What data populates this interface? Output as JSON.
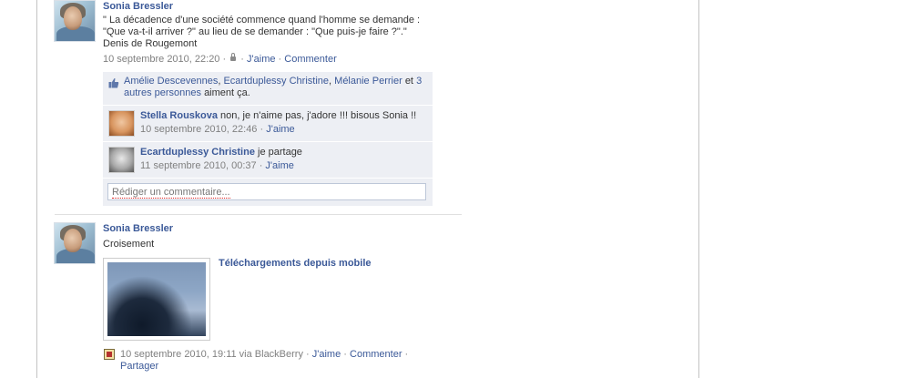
{
  "post1": {
    "author": "Sonia Bressler",
    "text_line1": "\" La décadence d'une société commence quand l'homme se demande :",
    "text_line2": "\"Que va-t-il arriver ?\" au lieu de se demander : \"Que puis-je faire ?\".\"",
    "text_line3": "Denis de Rougemont",
    "date": "10 septembre 2010, 22:20",
    "like_label": "J'aime",
    "comment_label": "Commenter",
    "likes": {
      "name1": "Amélie Descevennes",
      "name2": "Ecartduplessy Christine",
      "name3": "Mélanie Perrier",
      "and": "et",
      "others": "3 autres personnes",
      "suffix": "aiment ça."
    },
    "comments": [
      {
        "author": "Stella Rouskova",
        "text": "non, je n'aime pas, j'adore !!! bisous Sonia !!",
        "date": "10 septembre 2010, 22:46",
        "like_label": "J'aime"
      },
      {
        "author": "Ecartduplessy Christine",
        "text": "je partage",
        "date": "11 septembre 2010, 00:37",
        "like_label": "J'aime"
      }
    ],
    "comment_placeholder": "Rédiger un commentaire..."
  },
  "post2": {
    "author": "Sonia Bressler",
    "text": "Croisement",
    "attachment_title": "Téléchargements depuis mobile",
    "date": "10 septembre 2010, 19:11 via BlackBerry",
    "like_label": "J'aime",
    "comment_label": "Commenter",
    "share_label": "Partager"
  },
  "icons": [
    "lock-icon",
    "like-thumb-icon",
    "blackberry-icon"
  ],
  "colors": {
    "link": "#3b5998",
    "meta": "#808080",
    "ufi_background": "#edeff4",
    "input_border": "#bdc7d8"
  }
}
